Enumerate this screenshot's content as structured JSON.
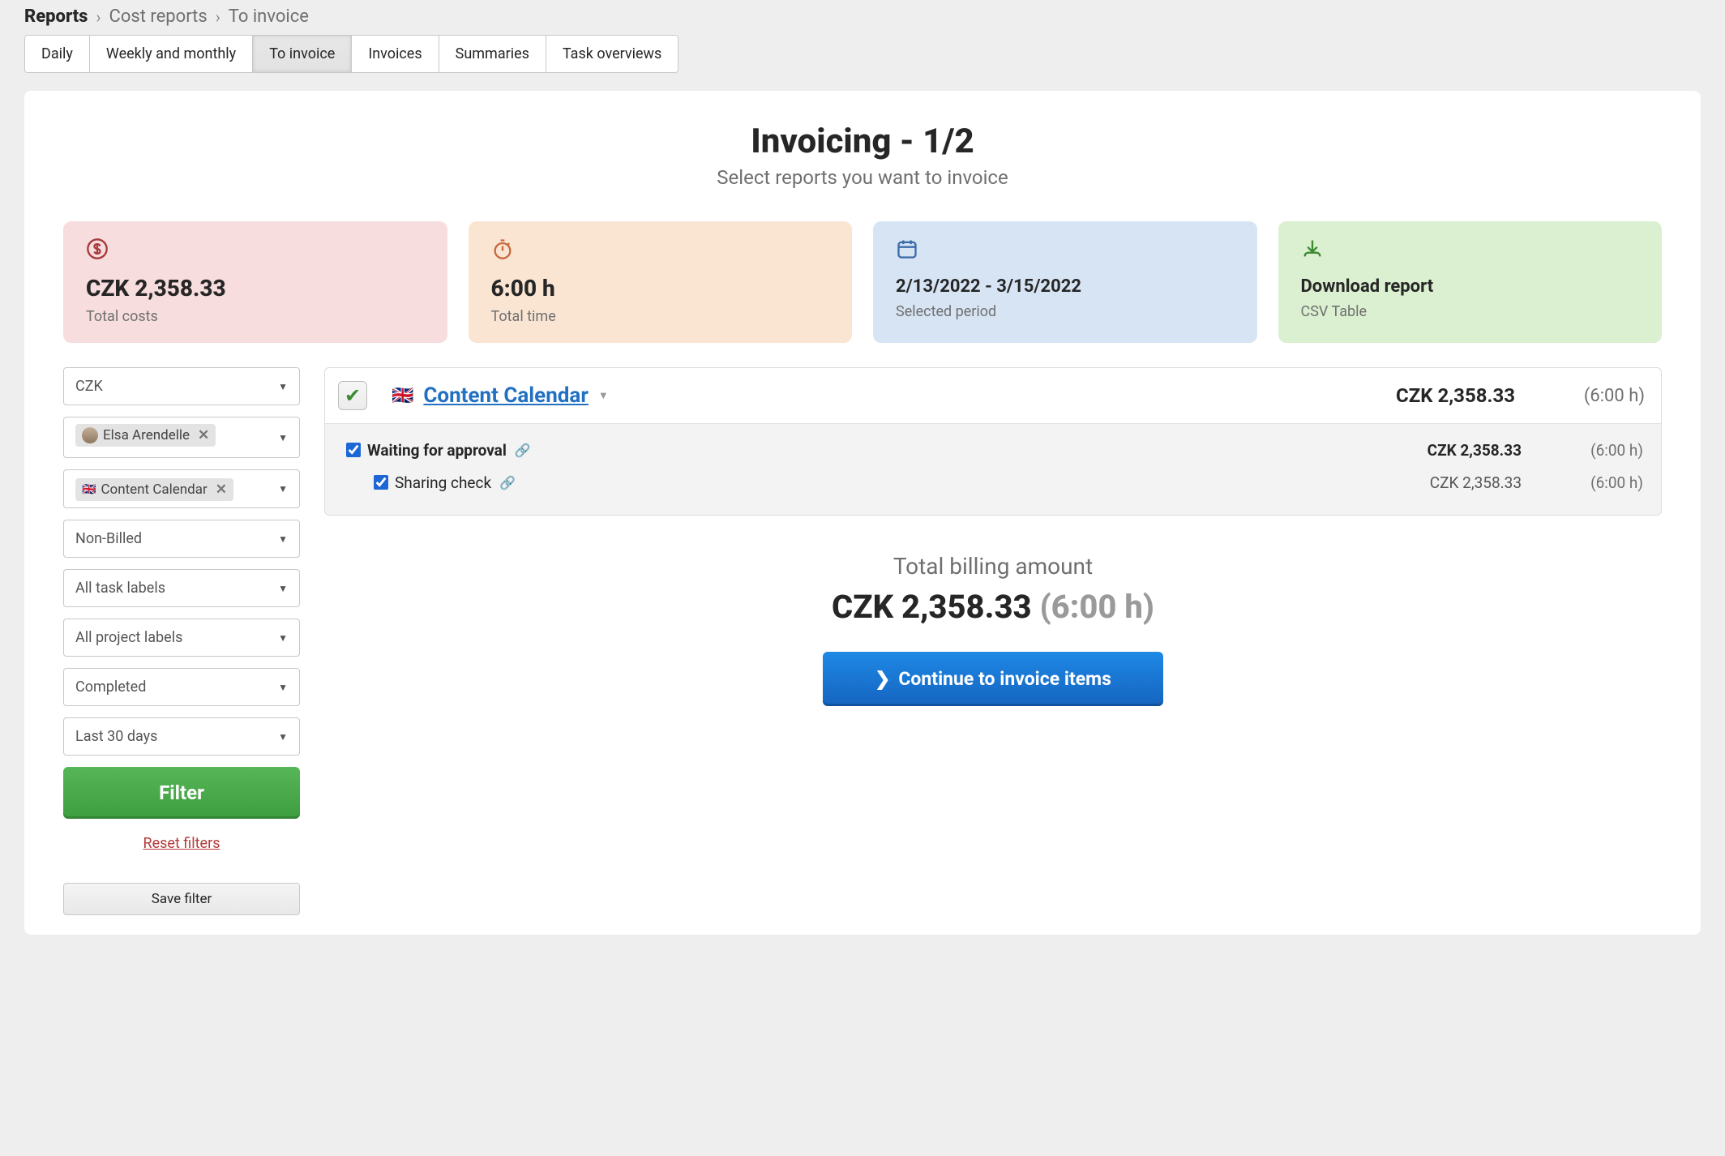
{
  "breadcrumb": {
    "root": "Reports",
    "mid": "Cost reports",
    "last": "To invoice"
  },
  "tabs": [
    "Daily",
    "Weekly and monthly",
    "To invoice",
    "Invoices",
    "Summaries",
    "Task overviews"
  ],
  "active_tab_index": 2,
  "title": "Invoicing - 1/2",
  "subtitle": "Select reports you want to invoice",
  "cards": {
    "costs": {
      "big": "CZK 2,358.33",
      "sub": "Total costs"
    },
    "time": {
      "big": "6:00 h",
      "sub": "Total time"
    },
    "period": {
      "med": "2/13/2022 - 3/15/2022",
      "sub": "Selected period"
    },
    "download": {
      "med": "Download report",
      "sub": "CSV Table"
    }
  },
  "filters": {
    "currency": "CZK",
    "person_chip": "Elsa Arendelle",
    "project_chip": "Content Calendar",
    "billed": "Non-Billed",
    "task_labels": "All task labels",
    "project_labels": "All project labels",
    "status": "Completed",
    "daterange": "Last 30 days",
    "filter_btn": "Filter",
    "reset": "Reset filters",
    "save": "Save filter"
  },
  "project": {
    "name": "Content Calendar",
    "amount": "CZK 2,358.33",
    "time": "(6:00 h)",
    "rows": [
      {
        "label": "Waiting for approval",
        "amount": "CZK 2,358.33",
        "time": "(6:00 h)",
        "bold": true,
        "indent": false
      },
      {
        "label": "Sharing check",
        "amount": "CZK 2,358.33",
        "time": "(6:00 h)",
        "bold": false,
        "indent": true
      }
    ]
  },
  "total": {
    "label": "Total billing amount",
    "amount": "CZK 2,358.33",
    "hours": "(6:00 h)"
  },
  "continue_btn": "Continue to invoice items"
}
